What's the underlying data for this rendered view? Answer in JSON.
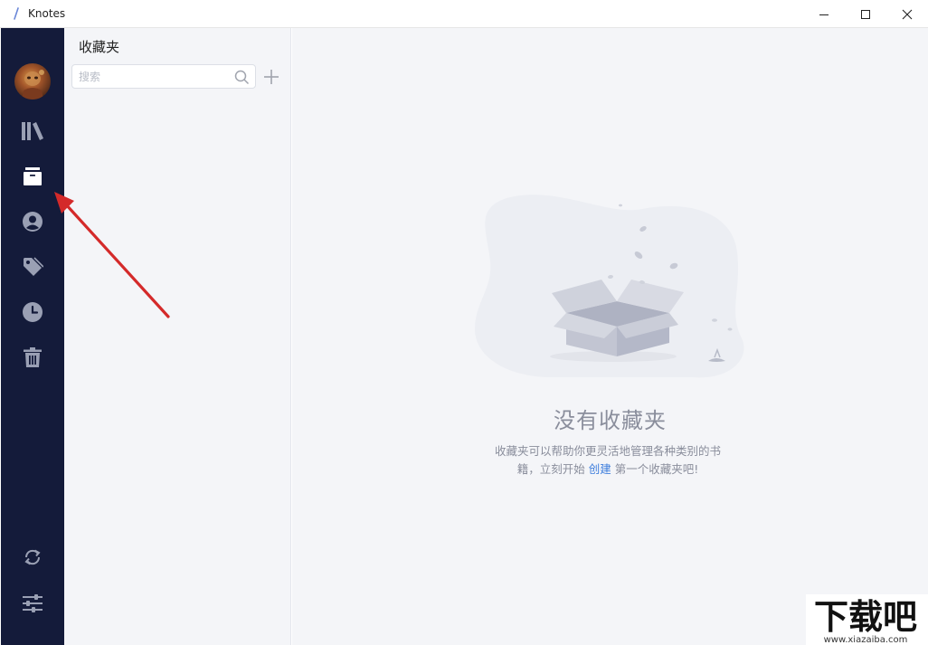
{
  "window": {
    "title": "Knotes"
  },
  "panel": {
    "title": "收藏夹",
    "search_placeholder": "搜索"
  },
  "empty_state": {
    "title": "没有收藏夹",
    "desc_line1": "收藏夹可以帮助你更灵活地管理各种类别的书",
    "desc_line2_before": "籍，立刻开始",
    "create_link": "创建",
    "desc_line2_after": "第一个收藏夹吧!"
  },
  "watermark": {
    "text": "下载吧",
    "url": "www.xiazaiba.com"
  },
  "icons": {
    "rail": [
      "library-icon",
      "archive-box-icon",
      "user-icon",
      "tag-icon",
      "clock-icon",
      "trash-icon",
      "sync-icon",
      "settings-sliders-icon"
    ]
  },
  "colors": {
    "rail_bg": "#141b3a",
    "rail_icon": "#9aa0b4",
    "rail_icon_active": "#ffffff",
    "panel_bg": "#f4f5f8",
    "link": "#3d7ddc",
    "annotation": "#d42a2a"
  }
}
